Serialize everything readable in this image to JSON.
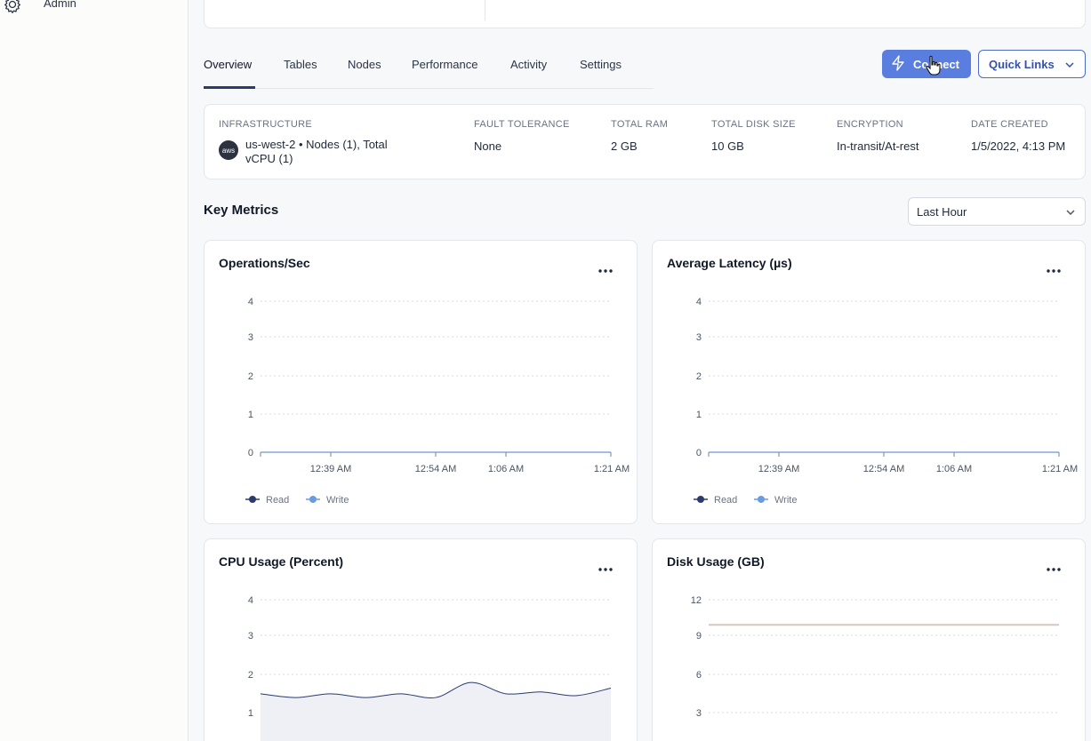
{
  "sidebar": {
    "admin_label": "Admin"
  },
  "tabs": [
    "Overview",
    "Tables",
    "Nodes",
    "Performance",
    "Activity",
    "Settings"
  ],
  "actions": {
    "connect_label": "Connect",
    "quick_links_label": "Quick Links"
  },
  "info": {
    "infrastructure": {
      "label": "INFRASTRUCTURE",
      "badge": "aws",
      "value": "us-west-2 • Nodes (1), Total vCPU (1)"
    },
    "fault_tolerance": {
      "label": "FAULT TOLERANCE",
      "value": "None"
    },
    "total_ram": {
      "label": "TOTAL RAM",
      "value": "2 GB"
    },
    "total_disk": {
      "label": "TOTAL DISK SIZE",
      "value": "10 GB"
    },
    "encryption": {
      "label": "ENCRYPTION",
      "value": "In-transit/At-rest"
    },
    "date_created": {
      "label": "DATE CREATED",
      "value": "1/5/2022, 4:13 PM"
    }
  },
  "metrics": {
    "title": "Key Metrics",
    "range": "Last Hour"
  },
  "colors": {
    "primary": "#5a7ee0",
    "read": "#2b3b6b",
    "write": "#6a9be0",
    "axis": "#6b86ad",
    "disk_line": "#d9c5bd"
  },
  "chart_data": [
    {
      "type": "line",
      "title": "Operations/Sec",
      "x": [
        "12:39 AM",
        "12:54 AM",
        "1:06 AM",
        "1:21 AM"
      ],
      "ylim": [
        0,
        4
      ],
      "yticks": [
        "4",
        "3",
        "2",
        "1",
        "0"
      ],
      "series": [
        {
          "name": "Read",
          "values": [
            0,
            0,
            0,
            0
          ]
        },
        {
          "name": "Write",
          "values": [
            0,
            0,
            0,
            0
          ]
        }
      ],
      "grid": true,
      "legend": "bottom-left"
    },
    {
      "type": "line",
      "title": "Average Latency (µs)",
      "x": [
        "12:39 AM",
        "12:54 AM",
        "1:06 AM",
        "1:21 AM"
      ],
      "ylim": [
        0,
        4
      ],
      "yticks": [
        "4",
        "3",
        "2",
        "1",
        "0"
      ],
      "series": [
        {
          "name": "Read",
          "values": [
            0,
            0,
            0,
            0
          ]
        },
        {
          "name": "Write",
          "values": [
            0,
            0,
            0,
            0
          ]
        }
      ],
      "grid": true,
      "legend": "bottom-left"
    },
    {
      "type": "area",
      "title": "CPU Usage (Percent)",
      "ylim": [
        0,
        4
      ],
      "yticks": [
        "4",
        "3",
        "2",
        "1"
      ],
      "series": [
        {
          "values": [
            1.5,
            1.4,
            1.5,
            1.4,
            1.5,
            1.4,
            1.8,
            1.5,
            1.55,
            1.45,
            1.65
          ]
        }
      ],
      "grid": true
    },
    {
      "type": "line",
      "title": "Disk Usage (GB)",
      "ylim": [
        0,
        12
      ],
      "yticks": [
        "12",
        "9",
        "6",
        "3"
      ],
      "series": [
        {
          "values": [
            10,
            10
          ]
        }
      ],
      "grid": true
    }
  ]
}
